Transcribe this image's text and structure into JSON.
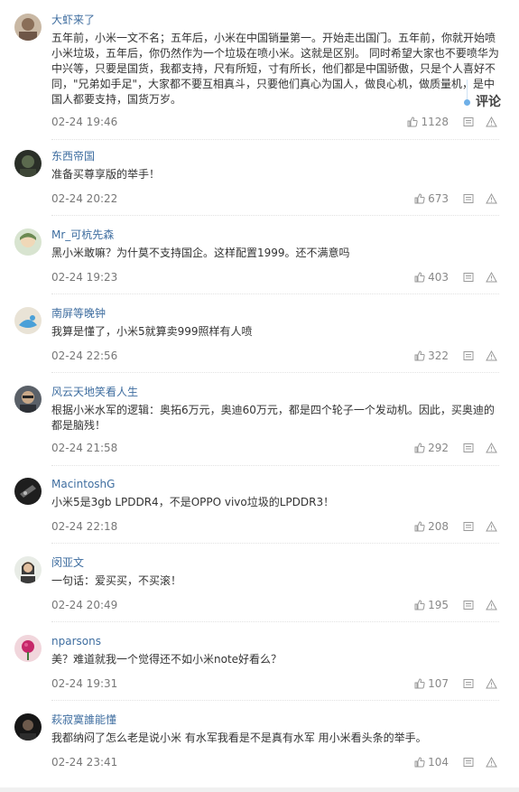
{
  "comments": [
    {
      "username": "大虾来了",
      "text": "五年前，小米一文不名；五年后，小米在中国销量第一。开始走出国门。五年前，你就开始喷小米垃圾，五年后，你仍然作为一个垃圾在喷小米。这就是区别。 同时希望大家也不要喷华为中兴等，只要是国货，我都支持，尺有所短，寸有所长，他们都是中国骄傲，只是个人喜好不同，\"兄弟如手足\"，大家都不要互相真斗，只要他们真心为国人，做良心机，做质量机，是中国人都要支持，国货万岁。",
      "time": "02-24 19:46",
      "likes": "1128"
    },
    {
      "username": "东西帝国",
      "text": "准备买尊享版的举手！",
      "time": "02-24 20:22",
      "likes": "673"
    },
    {
      "username": "Mr_可杭先森",
      "text": "黑小米敢嘛？为什莫不支持国企。这样配置1999。还不满意吗",
      "time": "02-24 19:23",
      "likes": "403"
    },
    {
      "username": "南屏等晚钟",
      "text": "我算是懂了，小米5就算卖999照样有人喷",
      "time": "02-24 22:56",
      "likes": "322"
    },
    {
      "username": "风云天地笑看人生",
      "text": "根据小米水军的逻辑：奥拓6万元，奥迪60万元，都是四个轮子一个发动机。因此，买奥迪的都是脑残！",
      "time": "02-24 21:58",
      "likes": "292"
    },
    {
      "username": "MacintoshG",
      "text": "小米5是3gb LPDDR4，不是OPPO vivo垃圾的LPDDR3！",
      "time": "02-24 22:18",
      "likes": "208"
    },
    {
      "username": "闵亚文",
      "text": "一句话：爱买买，不买滚！",
      "time": "02-24 20:49",
      "likes": "195"
    },
    {
      "username": "nparsons",
      "text": "美？难道就我一个觉得还不如小米note好看么？",
      "time": "02-24 19:31",
      "likes": "107"
    },
    {
      "username": "萩寂寞誰能懂",
      "text": "我都纳闷了怎么老是说小米 有水军我看是不是真有水军 用小米看头条的举手。",
      "time": "02-24 23:41",
      "likes": "104"
    }
  ],
  "float_button": {
    "label": "评论"
  },
  "colors": {
    "username": "#3f6ea0",
    "accent": "#6fb0e8",
    "meta": "#777777"
  },
  "icons": {
    "like": "thumbs-up-icon",
    "reply": "reply-icon",
    "report": "report-icon"
  }
}
